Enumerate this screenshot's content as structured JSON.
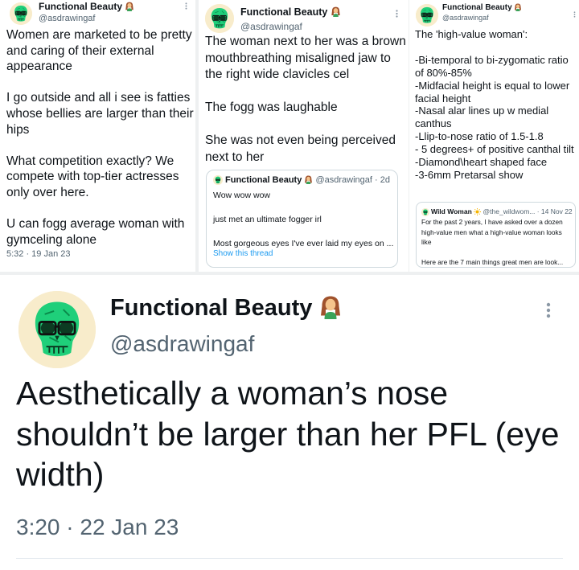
{
  "tweet_left": {
    "author_name": "Functional Beauty",
    "handle": "@asdrawingaf",
    "text": "Women are marketed to be pretty and caring of their external appearance\n\nI go outside and all i see is fatties whose bellies are larger than their hips\n\nWhat competition exactly? We compete with top-tier actresses only over here.\n\nU can fogg average woman with gymceling alone",
    "timestamp": "5:32 · 19 Jan 23"
  },
  "tweet_middle": {
    "author_name": "Functional Beauty",
    "handle": "@asdrawingaf",
    "text": "The woman next to her was a brown mouthbreathing misaligned jaw to the right wide clavicles cel\n\nThe fogg was laughable\n\nShe was not even being perceived next to her",
    "quote": {
      "author_name": "Functional Beauty",
      "meta": "@asdrawingaf · 2d",
      "text": "Wow wow wow\n\njust met an ultimate fogger irl\n\nMost gorgeous eyes I've ever laid my eyes on ...",
      "link": "Show this thread"
    }
  },
  "tweet_right": {
    "author_name": "Functional Beauty",
    "handle": "@asdrawingaf",
    "text": "The 'high-value woman':\n\n-Bi-temporal to bi-zygomatic ratio of 80%-85%\n-Midfacial height is equal to lower facial height\n-Nasal alar lines up w medial canthus\n-Llip-to-nose ratio of 1.5-1.8\n- 5 degrees+ of positive canthal tilt\n-Diamond\\heart shaped face\n-3-6mm Pretarsal show",
    "quote": {
      "author_name": "Wild Woman",
      "meta": "@the_wildwom... · 14 Nov 22",
      "text": "For the past 2 years, I have asked over a dozen high-value men what a high-value woman looks like\n\nHere are the 7 main things great men are look..."
    }
  },
  "main_tweet": {
    "author_name": "Functional Beauty",
    "handle": "@asdrawingaf",
    "text": "Aesthetically a woman’s nose shouldn’t be larger than her PFL (eye width)",
    "timestamp": "3:20 · 22 Jan 23"
  },
  "icons": {
    "avatar": "green-skull-with-glasses-avatar",
    "name_emoji": "woman-emoji",
    "quote_emoji": "sun-emoji",
    "more": "more-options-icon"
  },
  "colors": {
    "text": "#0f1419",
    "secondary": "#536471",
    "link": "#1d9bf0",
    "skull": "#1fcf7a",
    "avatar_bg": "#f8eccb"
  }
}
